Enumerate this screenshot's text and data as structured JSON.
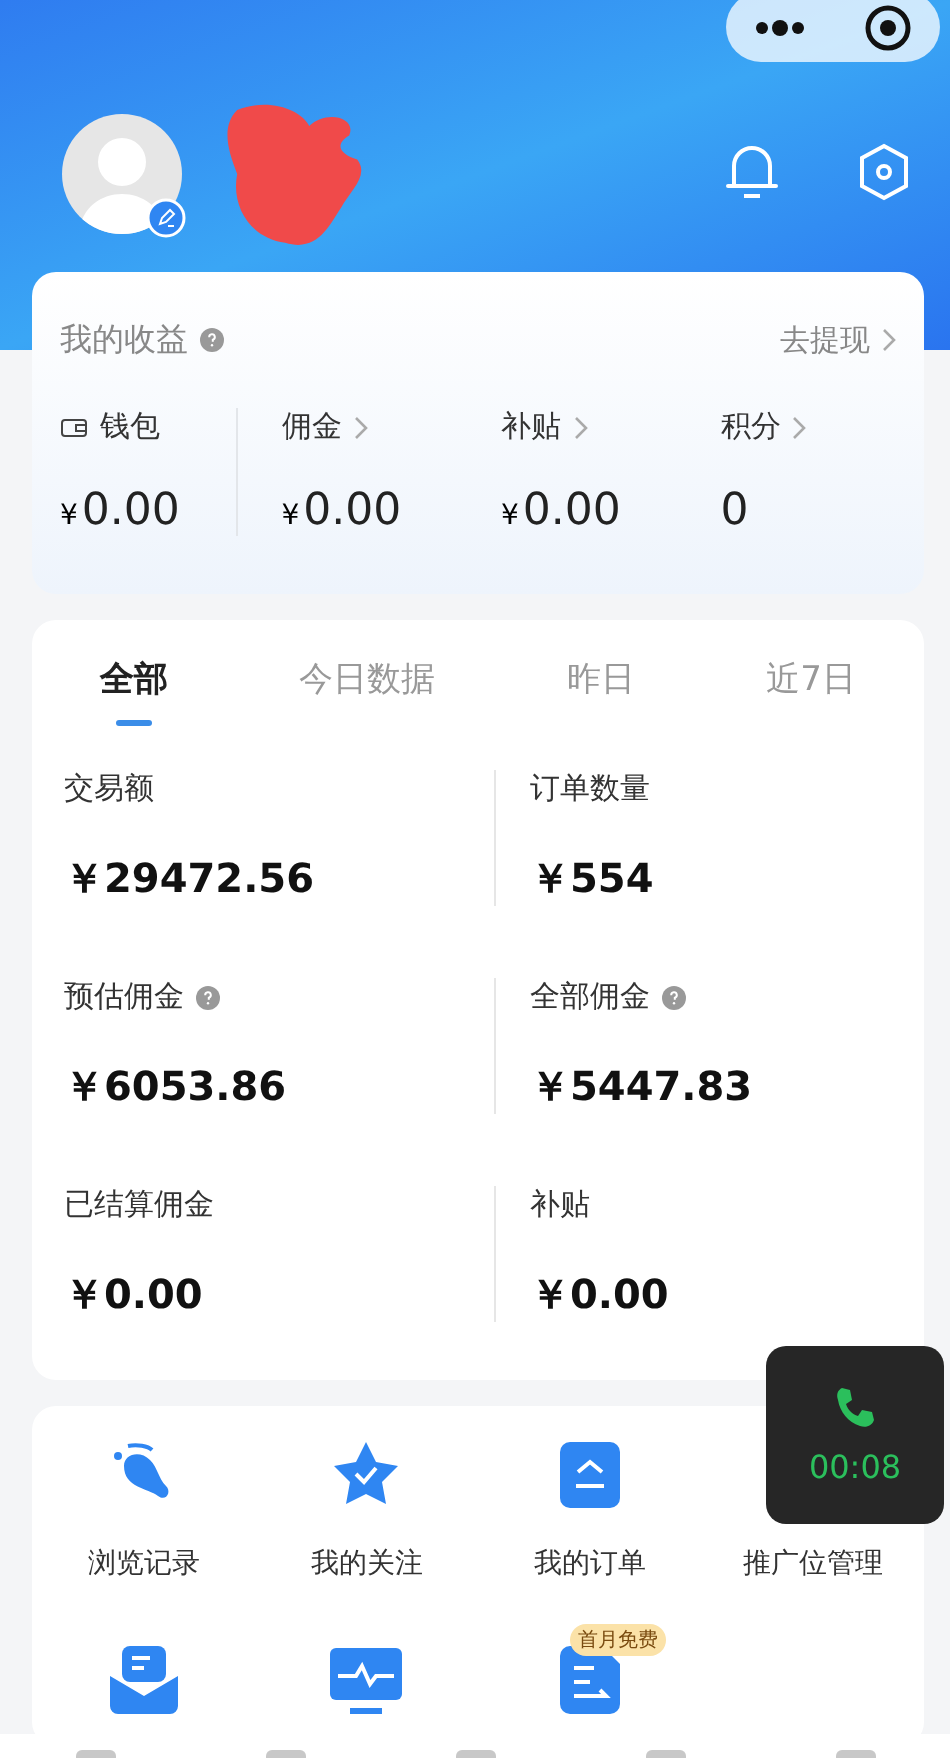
{
  "earnings": {
    "title": "我的收益",
    "action": "去提现",
    "items": [
      {
        "kind": "wallet",
        "label": "钱包",
        "currency": "¥",
        "value": "0.00"
      },
      {
        "kind": "link",
        "label": "佣金",
        "currency": "¥",
        "value": "0.00"
      },
      {
        "kind": "link",
        "label": "补贴",
        "currency": "¥",
        "value": "0.00"
      },
      {
        "kind": "link",
        "label": "积分",
        "value": "0"
      }
    ]
  },
  "tabs": [
    {
      "label": "全部",
      "selected": true
    },
    {
      "label": "今日数据",
      "selected": false
    },
    {
      "label": "昨日",
      "selected": false
    },
    {
      "label": "近7日",
      "selected": false
    }
  ],
  "stats": [
    {
      "label": "交易额",
      "value": "￥29472.56",
      "info": false
    },
    {
      "label": "订单数量",
      "value": "￥554",
      "info": false
    },
    {
      "label": "预估佣金",
      "value": "￥6053.86",
      "info": true
    },
    {
      "label": "全部佣金",
      "value": "￥5447.83",
      "info": true
    },
    {
      "label": "已结算佣金",
      "value": "￥0.00",
      "info": false
    },
    {
      "label": "补贴",
      "value": "￥0.00",
      "info": false
    }
  ],
  "shortcuts": [
    {
      "kind": "footprint",
      "label": "浏览记录"
    },
    {
      "kind": "star",
      "label": "我的关注"
    },
    {
      "kind": "order",
      "label": "我的订单"
    },
    {
      "kind": "hidden",
      "label": "推广位管理"
    },
    {
      "kind": "mail"
    },
    {
      "kind": "monitor"
    },
    {
      "kind": "document",
      "badge": "首月免费"
    }
  ],
  "call": {
    "time": "00:08"
  }
}
